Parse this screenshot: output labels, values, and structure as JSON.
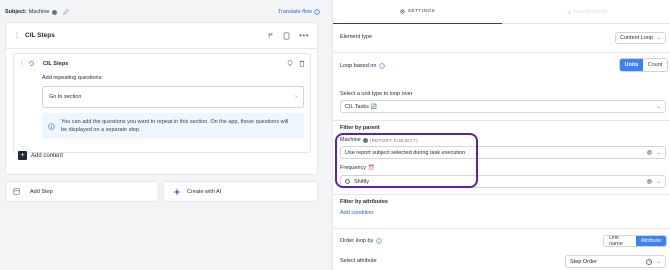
{
  "left": {
    "subject_label": "Subject:",
    "subject_value": "Machine",
    "translate_label": "Translate flow",
    "steps_title": "CIL Steps",
    "substep": {
      "title": "CIL Steps",
      "add_repeating_label": "Add repeating questions:",
      "goto_label": "Go to section",
      "info_text_1": "You can add the questions you want to repeat in this section. On the app, these questions will",
      "info_text_2": "be displayed on a separate step."
    },
    "add_content_label": "Add content",
    "add_step_label": "Add Step",
    "create_ai_label": "Create with AI"
  },
  "right": {
    "tabs": [
      {
        "label": "SETTINGS",
        "active": true
      },
      {
        "label": "NAVIGATION",
        "active": false
      }
    ],
    "element_type_label": "Element type",
    "element_type_value": "Content Loop",
    "loop_based_label": "Loop based on",
    "loop_options": [
      "Units",
      "Count"
    ],
    "loop_selected": "Units",
    "unit_type_label": "Select a unit type to loop over",
    "unit_type_value": "CIL Tasks",
    "unit_type_emoji": "🔄",
    "filter_parent_label": "Filter by parent",
    "machine_label": "Machine",
    "report_subject_tag": "(REPORT SUBJECT)",
    "machine_value": "Use report subject selected during task execution",
    "frequency_label": "Frequency",
    "frequency_emoji": "⏰",
    "frequency_value": "Shiftly",
    "filter_attr_label": "Filter by attributes",
    "add_condition_label": "Add condition",
    "order_label": "Order loop by",
    "order_options": [
      "Unit name",
      "Attribute"
    ],
    "order_selected": "Attribute",
    "select_attr_label": "Select attribute",
    "select_attr_value": "Step Order"
  },
  "colors": {
    "accent": "#3b82f6",
    "highlight": "#5b21b6",
    "link": "#2563eb"
  }
}
